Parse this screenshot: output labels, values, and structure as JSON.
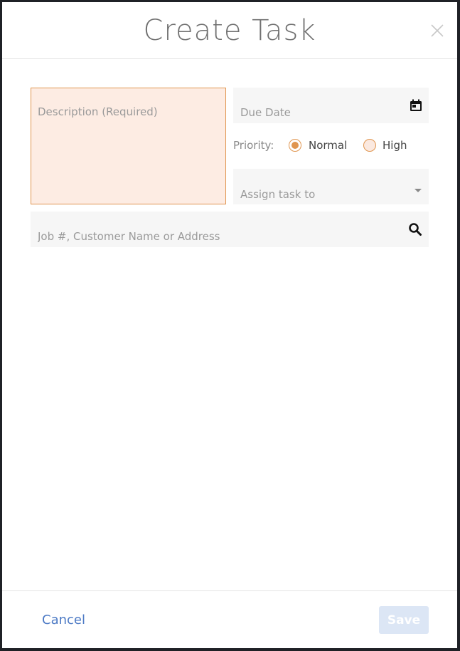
{
  "header": {
    "title": "Create Task",
    "close_icon": "close-icon"
  },
  "form": {
    "description": {
      "placeholder": "Description (Required)",
      "value": ""
    },
    "due_date": {
      "placeholder": "Due Date",
      "value": "",
      "icon": "calendar-icon"
    },
    "priority": {
      "label": "Priority:",
      "options": [
        {
          "label": "Normal",
          "selected": true
        },
        {
          "label": "High",
          "selected": false
        }
      ]
    },
    "assign": {
      "placeholder": "Assign task to",
      "icon": "chevron-down-icon"
    },
    "job_search": {
      "placeholder": "Job #, Customer Name or Address",
      "value": "",
      "icon": "search-icon"
    }
  },
  "footer": {
    "cancel_label": "Cancel",
    "save_label": "Save"
  },
  "colors": {
    "accent": "#e0954f",
    "link": "#4a78c4",
    "save_disabled": "#dce6f5",
    "required_bg": "#fdece3"
  }
}
